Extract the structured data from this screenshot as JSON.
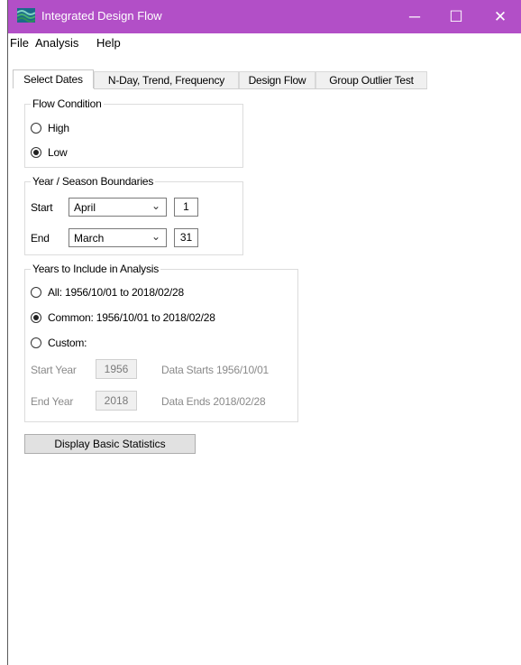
{
  "window": {
    "title": "Integrated Design Flow",
    "controls": {
      "minimize": "─",
      "maximize": "☐",
      "close": "✕"
    },
    "accent_color": "#b24fc7"
  },
  "menu": {
    "file": "File",
    "analysis": "Analysis",
    "help": "Help"
  },
  "tabs": [
    {
      "label": "Select Dates",
      "active": true
    },
    {
      "label": "N-Day, Trend, Frequency",
      "active": false
    },
    {
      "label": "Design Flow",
      "active": false
    },
    {
      "label": "Group Outlier Test",
      "active": false
    }
  ],
  "flow_condition": {
    "legend": "Flow Condition",
    "high_label": "High",
    "low_label": "Low",
    "selected": "Low"
  },
  "boundaries": {
    "legend": "Year / Season Boundaries",
    "start_label": "Start",
    "start_month": "April",
    "start_day": "1",
    "end_label": "End",
    "end_month": "March",
    "end_day": "31"
  },
  "years": {
    "legend": "Years to Include in Analysis",
    "all_label": "All: 1956/10/01 to 2018/02/28",
    "common_label": "Common: 1956/10/01 to 2018/02/28",
    "custom_label": "Custom:",
    "selected": "Common",
    "start_year_label": "Start Year",
    "start_year_value": "1956",
    "data_starts": "Data Starts 1956/10/01",
    "end_year_label": "End Year",
    "end_year_value": "2018",
    "data_ends": "Data Ends 2018/02/28"
  },
  "actions": {
    "display_stats": "Display Basic Statistics"
  },
  "icons": {
    "app": "wave-flow-icon",
    "dropdown": "chevron-down-icon"
  }
}
